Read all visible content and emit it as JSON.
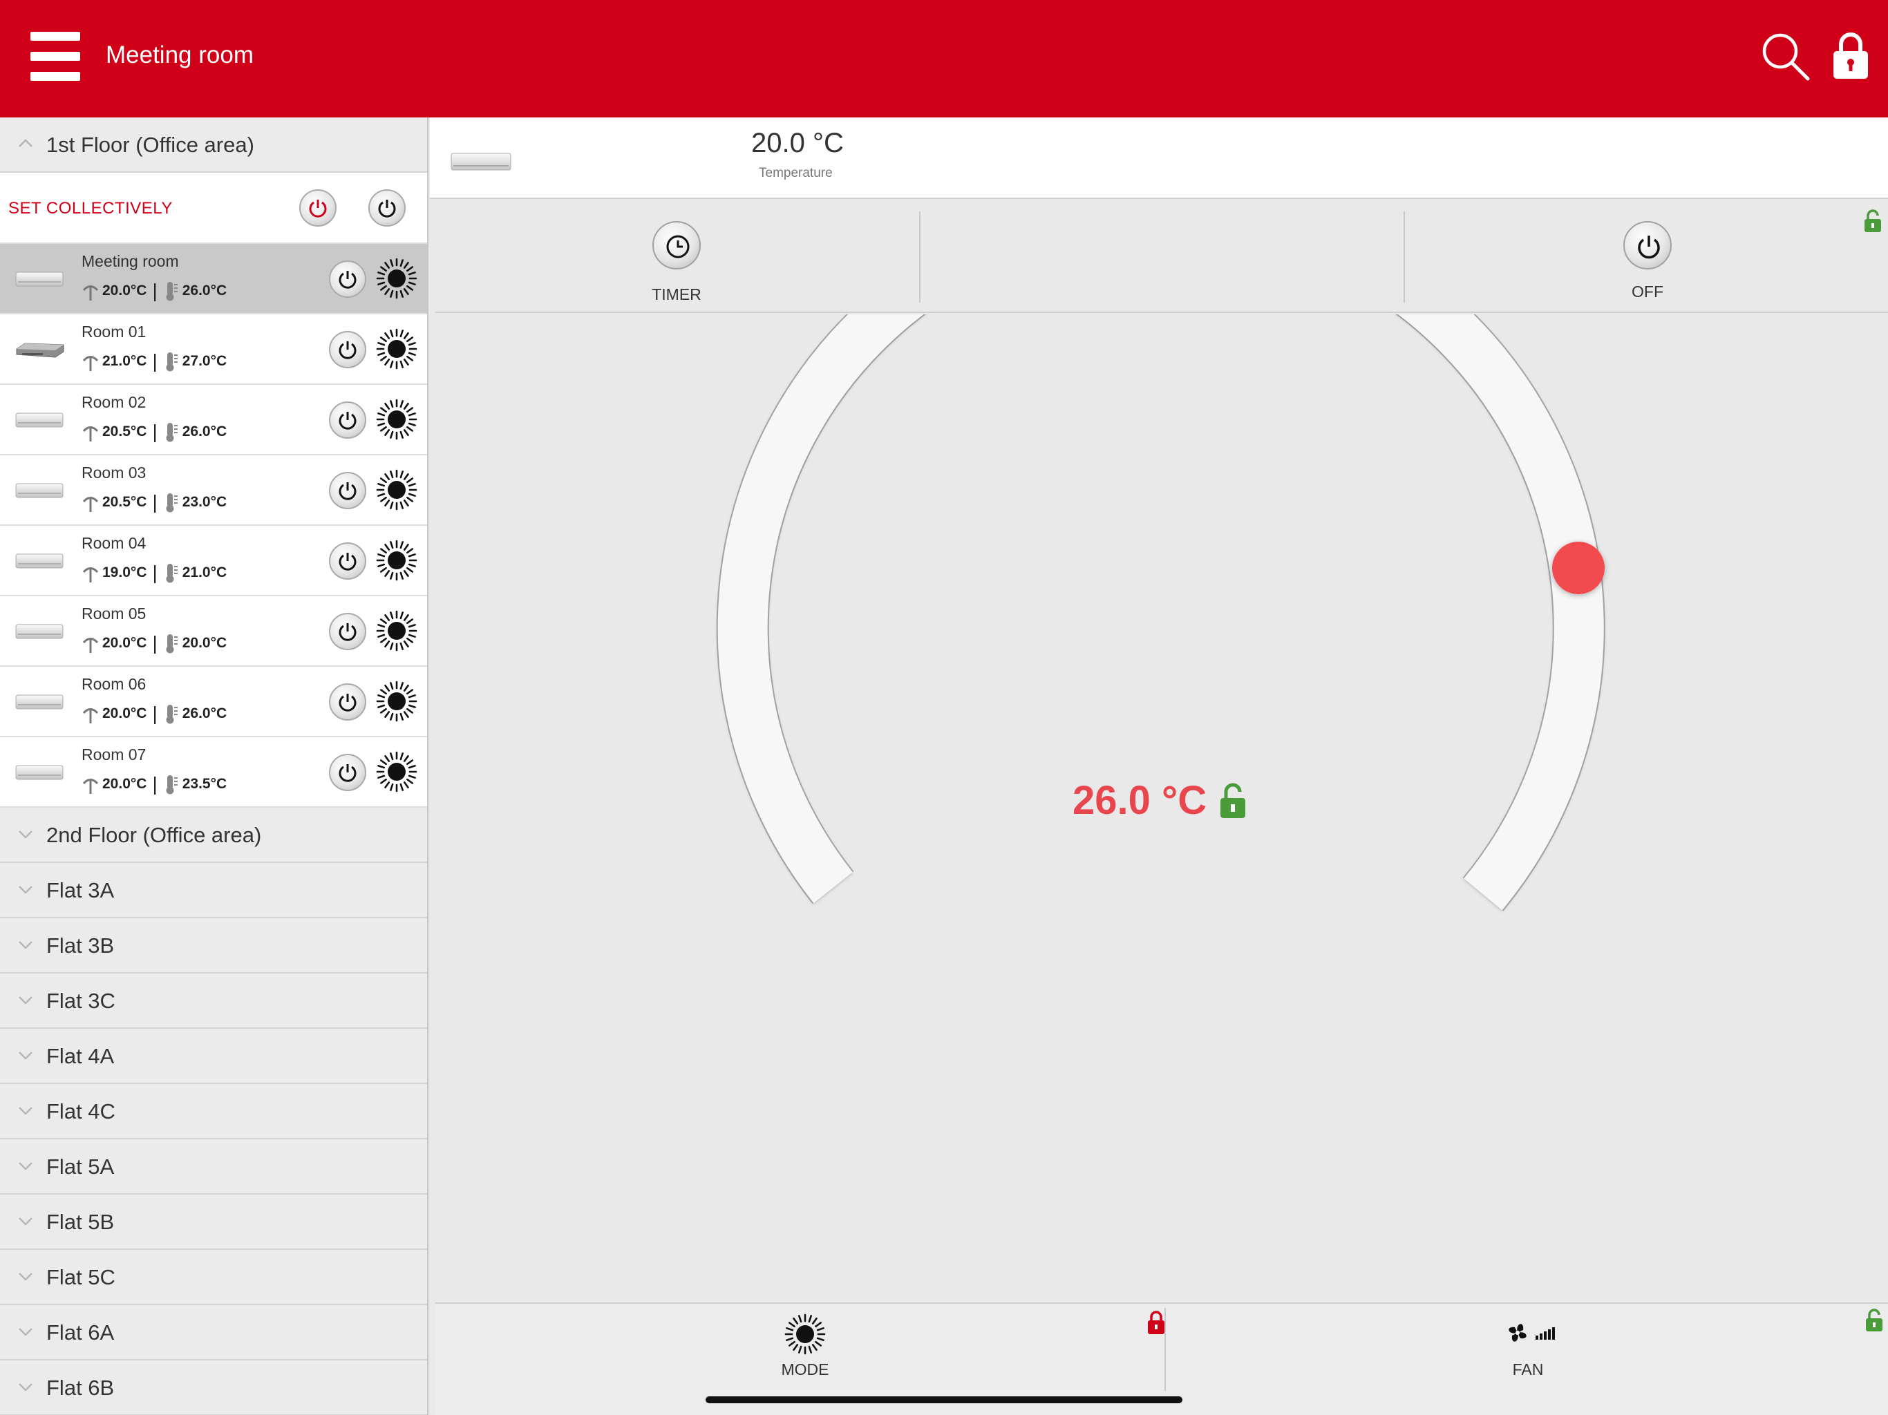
{
  "header": {
    "title": "Meeting room",
    "menu_icon": "hamburger-icon",
    "search_icon": "search-icon",
    "lock_icon": "lock-icon"
  },
  "colors": {
    "brand_red": "#d10019",
    "setpoint_red": "#e8464c",
    "lock_green": "#4a9b3a",
    "lock_red": "#d10019"
  },
  "sidebar": {
    "group_open": {
      "label": "1st Floor (Office area)"
    },
    "set_collectively": {
      "label": "SET COLLECTIVELY"
    },
    "rooms": [
      {
        "name": "Meeting room",
        "room_temp": "20.0°C",
        "set_temp": "26.0°C",
        "unit": "wall",
        "selected": true
      },
      {
        "name": "Room 01",
        "room_temp": "21.0°C",
        "set_temp": "27.0°C",
        "unit": "duct"
      },
      {
        "name": "Room 02",
        "room_temp": "20.5°C",
        "set_temp": "26.0°C",
        "unit": "wall"
      },
      {
        "name": "Room 03",
        "room_temp": "20.5°C",
        "set_temp": "23.0°C",
        "unit": "wall"
      },
      {
        "name": "Room 04",
        "room_temp": "19.0°C",
        "set_temp": "21.0°C",
        "unit": "wall"
      },
      {
        "name": "Room 05",
        "room_temp": "20.0°C",
        "set_temp": "20.0°C",
        "unit": "wall"
      },
      {
        "name": "Room 06",
        "room_temp": "20.0°C",
        "set_temp": "26.0°C",
        "unit": "wall"
      },
      {
        "name": "Room 07",
        "room_temp": "20.0°C",
        "set_temp": "23.5°C",
        "unit": "wall"
      }
    ],
    "groups": [
      "2nd Floor (Office area)",
      "Flat 3A",
      "Flat 3B",
      "Flat 3C",
      "Flat 4A",
      "Flat 4C",
      "Flat 5A",
      "Flat 5B",
      "Flat 5C",
      "Flat 6A",
      "Flat 6B"
    ]
  },
  "main": {
    "room_temperature": "20.0 °C",
    "room_temperature_label": "Temperature",
    "timer_label": "TIMER",
    "power_label": "OFF",
    "setpoint": "26.0 °C",
    "mode_label": "MODE",
    "fan_label": "FAN"
  }
}
